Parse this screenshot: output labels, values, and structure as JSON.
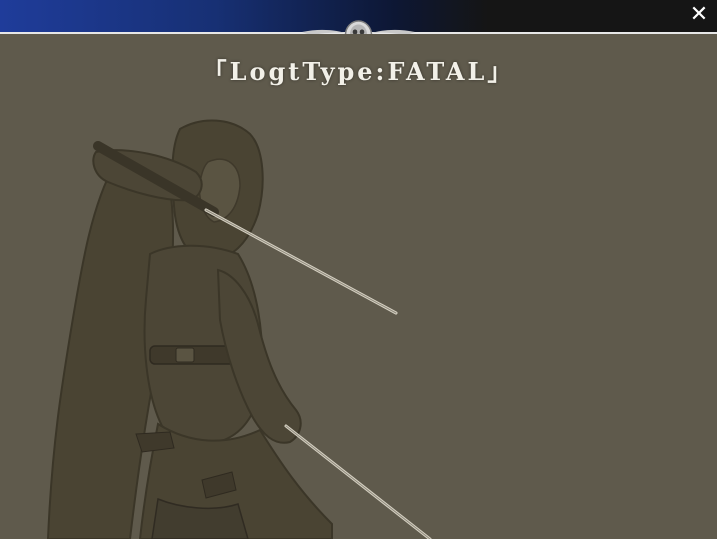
{
  "window": {
    "close_symbol": "✕",
    "close_icon": "close-icon"
  },
  "dialog": {
    "title": "「LogtType:FATAL」"
  },
  "colors": {
    "titlebar_left": "#1f3c9a",
    "titlebar_right": "#151515",
    "background": "#5f5a4c",
    "silhouette": "#4a4433"
  }
}
